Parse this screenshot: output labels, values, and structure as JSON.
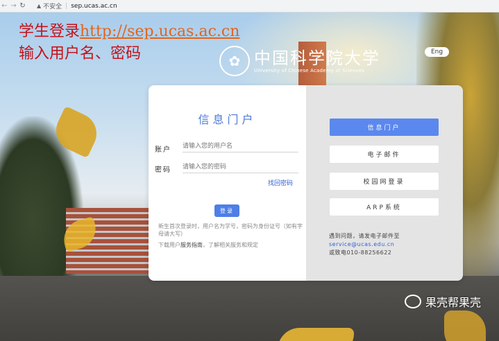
{
  "browser": {
    "security_label": "不安全",
    "url": "sep.ucas.ac.cn"
  },
  "overlay": {
    "line1_prefix": "学生登录",
    "line1_link": "http://sep.ucas.ac.cn",
    "line2": "输入用户名、密码"
  },
  "header": {
    "logo_cn": "中国科学院大学",
    "logo_en": "University of Chinese Academy of Sciences",
    "lang_button": "Eng"
  },
  "login": {
    "title": "信息门户",
    "account_label": "账户",
    "account_placeholder": "请输入您的用户名",
    "password_label": "密码",
    "password_placeholder": "请输入您的密码",
    "forgot": "找回密码",
    "submit": "登录",
    "hint": "新生首次登录时，用户名为学号，密码为身份证号（如有字母请大写）",
    "guide_prefix": "下载用户",
    "guide_link": "服务指南",
    "guide_suffix": "，了解相关服务和规定"
  },
  "services": {
    "items": [
      "信息门户",
      "电子邮件",
      "校园网登录",
      "ARP系统"
    ],
    "contact_line1": "遇到问题，请发电子邮件至",
    "contact_email": "service@ucas.edu.cn",
    "contact_line3": "或致电010-88256622"
  },
  "watermark": "果壳帮果壳"
}
